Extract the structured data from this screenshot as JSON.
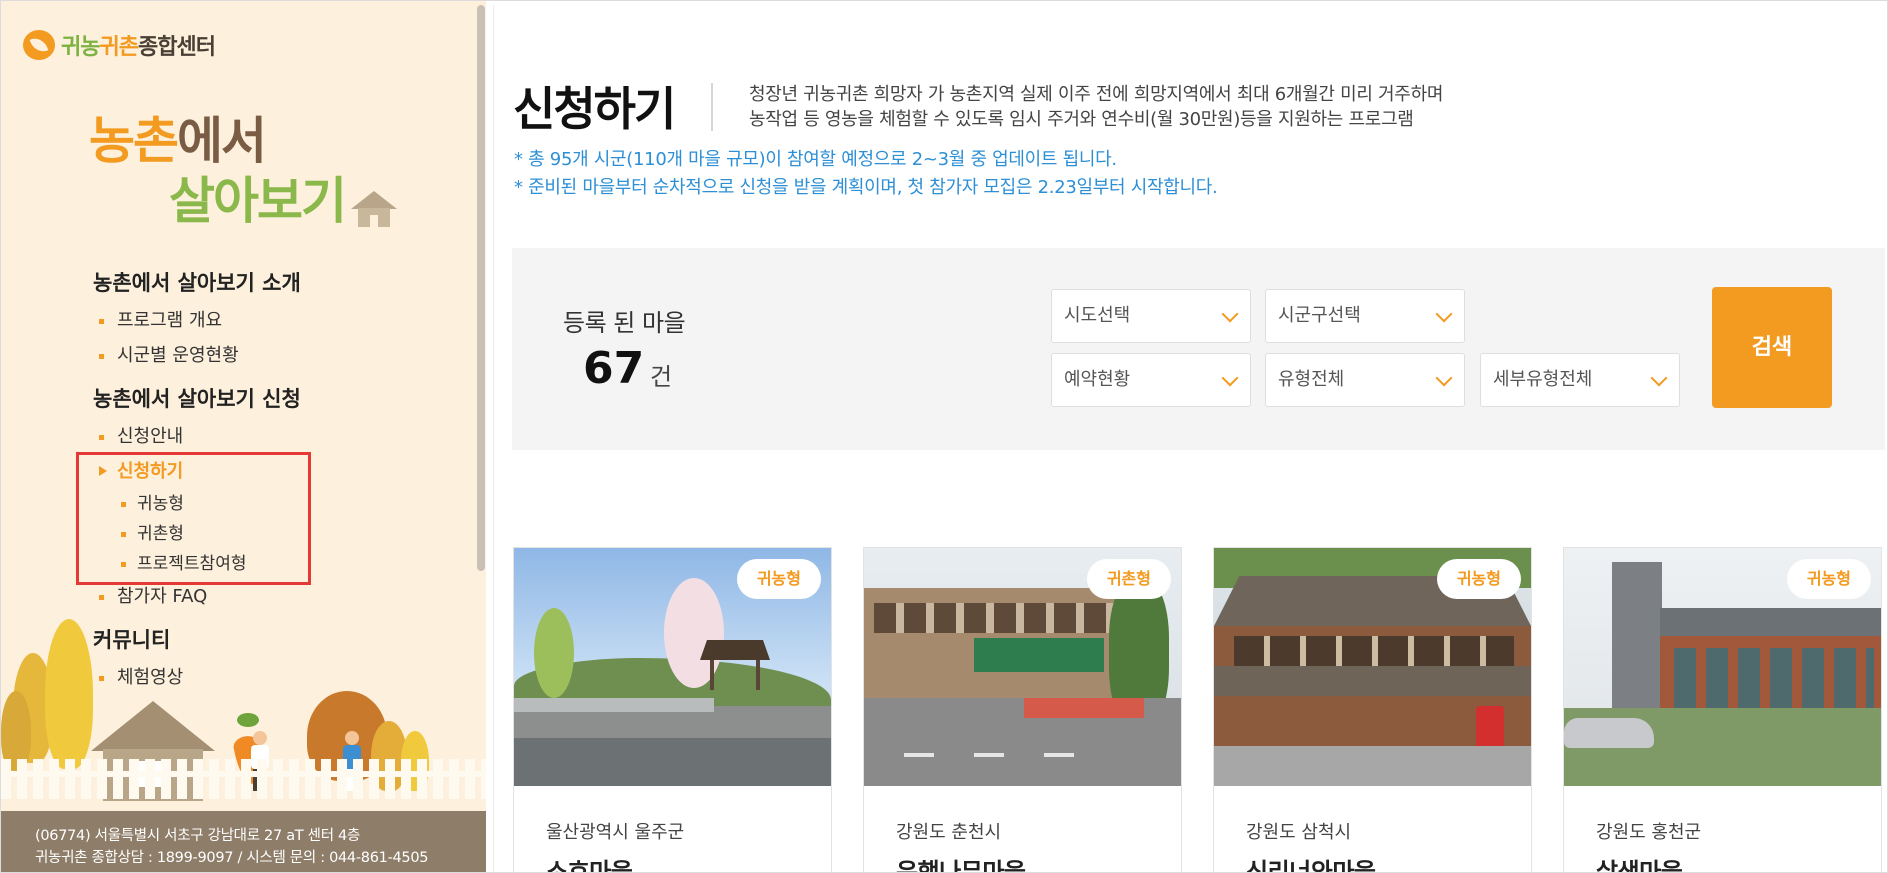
{
  "sidebar": {
    "logo_text_a": "귀농",
    "logo_text_b": "귀촌",
    "logo_text_c": "종합센터",
    "hero_line1_a": "농촌",
    "hero_line1_b": "에서",
    "hero_line2": "살아보기",
    "sections": [
      {
        "title": "농촌에서 살아보기 소개",
        "items": [
          "프로그램 개요",
          "시군별 운영현황"
        ]
      },
      {
        "title": "농촌에서 살아보기 신청",
        "items": [
          "신청안내",
          "신청하기",
          "참가자 FAQ"
        ],
        "subitems": [
          "귀농형",
          "귀촌형",
          "프로젝트참여형"
        ]
      },
      {
        "title": "커뮤니티",
        "items": [
          "체험영상"
        ]
      }
    ],
    "footer_line1": "(06774) 서울특별시 서초구 강남대로 27 aT 센터 4층",
    "footer_line2": "귀농귀촌 종합상담 : 1899-9097 / 시스템 문의 : 044-861-4505"
  },
  "main": {
    "title": "신청하기",
    "desc_line1": "청장년 귀농귀촌 희망자 가 농촌지역 실제 이주 전에 희망지역에서 최대 6개월간 미리 거주하며",
    "desc_line2": "농작업 등 영농을 체험할 수 있도록 임시 주거와 연수비(월 30만원)등을 지원하는 프로그램",
    "notice1": "* 총 95개 시군(110개 마을 규모)이 참여할 예정으로 2~3월 중 업데이트 됩니다.",
    "notice2": "* 준비된 마을부터 순차적으로 신청을 받을 계획이며, 첫 참가자 모집은 2.23일부터 시작합니다."
  },
  "search": {
    "count_label": "등록 된 마을",
    "count": "67",
    "count_unit": "건",
    "select_sido": "시도선택",
    "select_sigungu": "시군구선택",
    "select_reserve": "예약현황",
    "select_type": "유형전체",
    "select_subtype": "세부유형전체",
    "button": "검색"
  },
  "cards": [
    {
      "badge": "귀농형",
      "region": "울산광역시 울주군",
      "village": "소호마을"
    },
    {
      "badge": "귀촌형",
      "region": "강원도 춘천시",
      "village": "은행나무마을"
    },
    {
      "badge": "귀농형",
      "region": "강원도 삼척시",
      "village": "신리너와마을"
    },
    {
      "badge": "귀농형",
      "region": "강원도 홍천군",
      "village": "살생마을"
    }
  ],
  "colors": {
    "accent": "#f39a21",
    "notice": "#2d8fd5",
    "sidebar_bg": "#fdf0dc",
    "highlight_box": "#e53935"
  }
}
